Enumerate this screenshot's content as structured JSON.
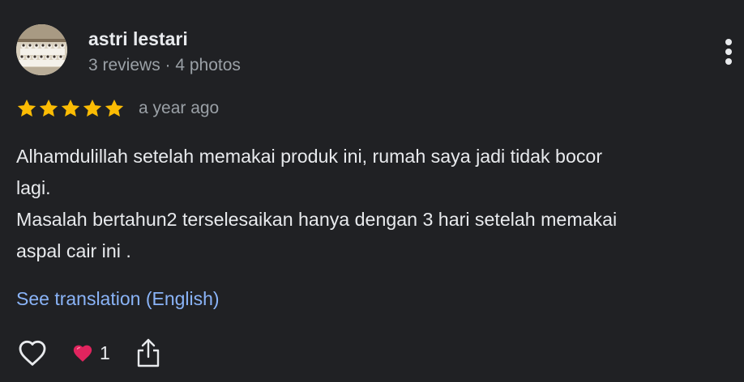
{
  "review": {
    "author": {
      "name": "astri lestari",
      "meta": "3 reviews · 4 photos",
      "avatar_icon": "group-photo-avatar"
    },
    "rating": {
      "stars": 5,
      "max_stars": 5,
      "star_color": "#fbbc04",
      "date": "a year ago"
    },
    "text_lines": [
      "Alhamdulillah setelah memakai produk ini, rumah saya jadi tidak bocor",
      "lagi.",
      "Masalah bertahun2 terselesaikan hanya dengan 3 hari setelah memakai",
      "aspal cair ini ."
    ],
    "translate_link": "See translation (English)",
    "actions": {
      "like_icon": "heart-outline-icon",
      "reaction_icon": "red-heart-emoji",
      "reaction_count": "1",
      "share_icon": "share-icon",
      "more_icon": "more-vertical-icon"
    }
  },
  "colors": {
    "background": "#202124",
    "text_primary": "#e8eaed",
    "text_secondary": "#9aa0a6",
    "link": "#8ab4f8",
    "star": "#fbbc04",
    "heart": "#e0245e"
  }
}
